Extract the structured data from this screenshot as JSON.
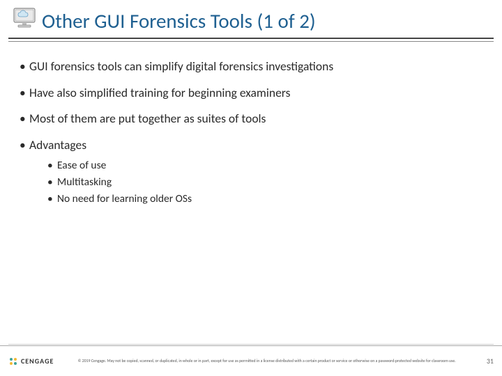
{
  "slide": {
    "title": "Other GUI Forensics Tools (1 of 2)",
    "bullets": [
      {
        "text": "GUI forensics tools can simplify digital forensics investigations"
      },
      {
        "text": "Have also simplified training for beginning examiners"
      },
      {
        "text": "Most of them are put together as suites of tools"
      },
      {
        "text": "Advantages",
        "sub": [
          "Ease of use",
          "Multitasking",
          "No need for learning older OSs"
        ]
      }
    ]
  },
  "footer": {
    "brand": "CENGAGE",
    "copyright": "© 2019 Cengage. May not be copied, scanned, or duplicated, in whole or in part, except for use as permitted in a license distributed with a certain product or service or otherwise on a password-protected website for classroom use.",
    "page": "31"
  }
}
